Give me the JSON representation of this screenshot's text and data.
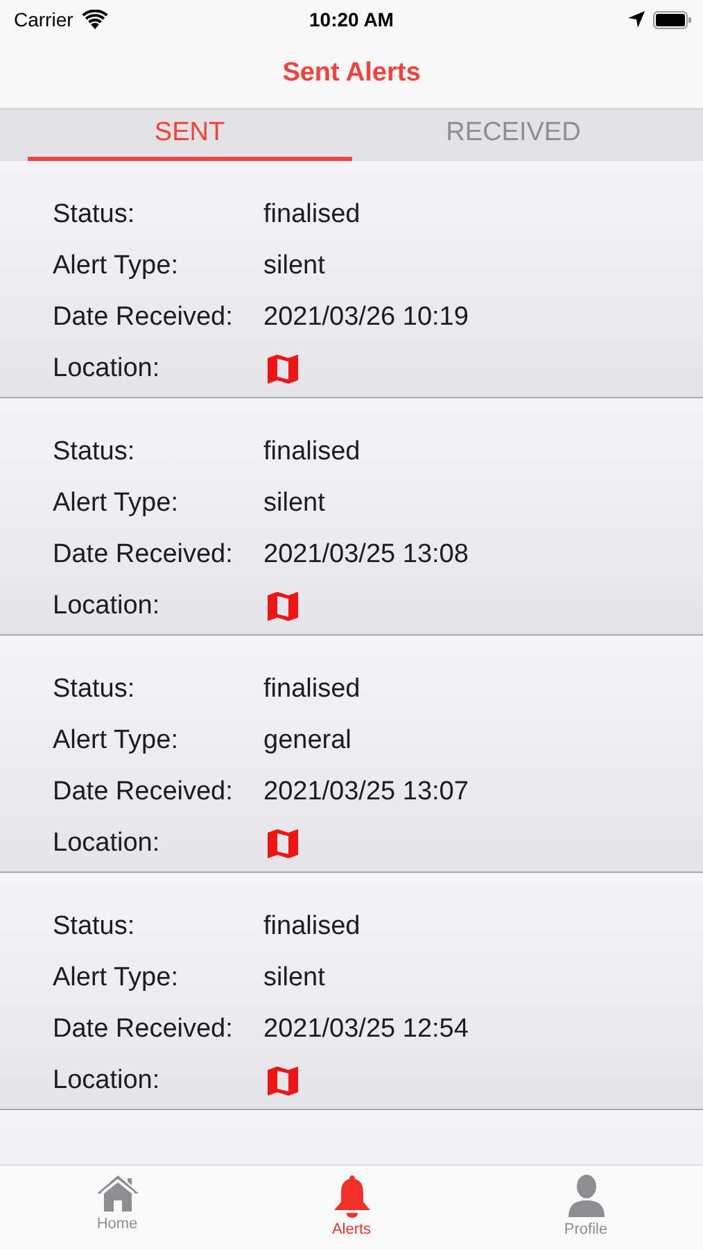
{
  "status_bar": {
    "carrier": "Carrier",
    "time": "10:20 AM"
  },
  "nav": {
    "title": "Sent Alerts"
  },
  "tabs": [
    {
      "label": "SENT",
      "selected": true
    },
    {
      "label": "RECEIVED",
      "selected": false
    }
  ],
  "alerts": [
    {
      "fields": [
        {
          "label": "Status:",
          "value": "finalised"
        },
        {
          "label": "Alert Type:",
          "value": "silent"
        },
        {
          "label": "Date Received:",
          "value": "2021/03/26 10:19"
        },
        {
          "label": "Location:",
          "kind": "map"
        }
      ]
    },
    {
      "fields": [
        {
          "label": "Status:",
          "value": "finalised"
        },
        {
          "label": "Alert Type:",
          "value": "silent"
        },
        {
          "label": "Date Received:",
          "value": "2021/03/25 13:08"
        },
        {
          "label": "Location:",
          "kind": "map"
        }
      ]
    },
    {
      "fields": [
        {
          "label": "Status:",
          "value": "finalised"
        },
        {
          "label": "Alert Type:",
          "value": "general"
        },
        {
          "label": "Date Received:",
          "value": "2021/03/25 13:07"
        },
        {
          "label": "Location:",
          "kind": "map"
        }
      ]
    },
    {
      "fields": [
        {
          "label": "Status:",
          "value": "finalised"
        },
        {
          "label": "Alert Type:",
          "value": "silent"
        },
        {
          "label": "Date Received:",
          "value": "2021/03/25 12:54"
        },
        {
          "label": "Location:",
          "kind": "map"
        }
      ]
    }
  ],
  "tab_bar": [
    {
      "label": "Home",
      "kind": "home",
      "selected": false
    },
    {
      "label": "Alerts",
      "kind": "bell",
      "selected": true
    },
    {
      "label": "Profile",
      "kind": "person",
      "selected": false
    }
  ]
}
